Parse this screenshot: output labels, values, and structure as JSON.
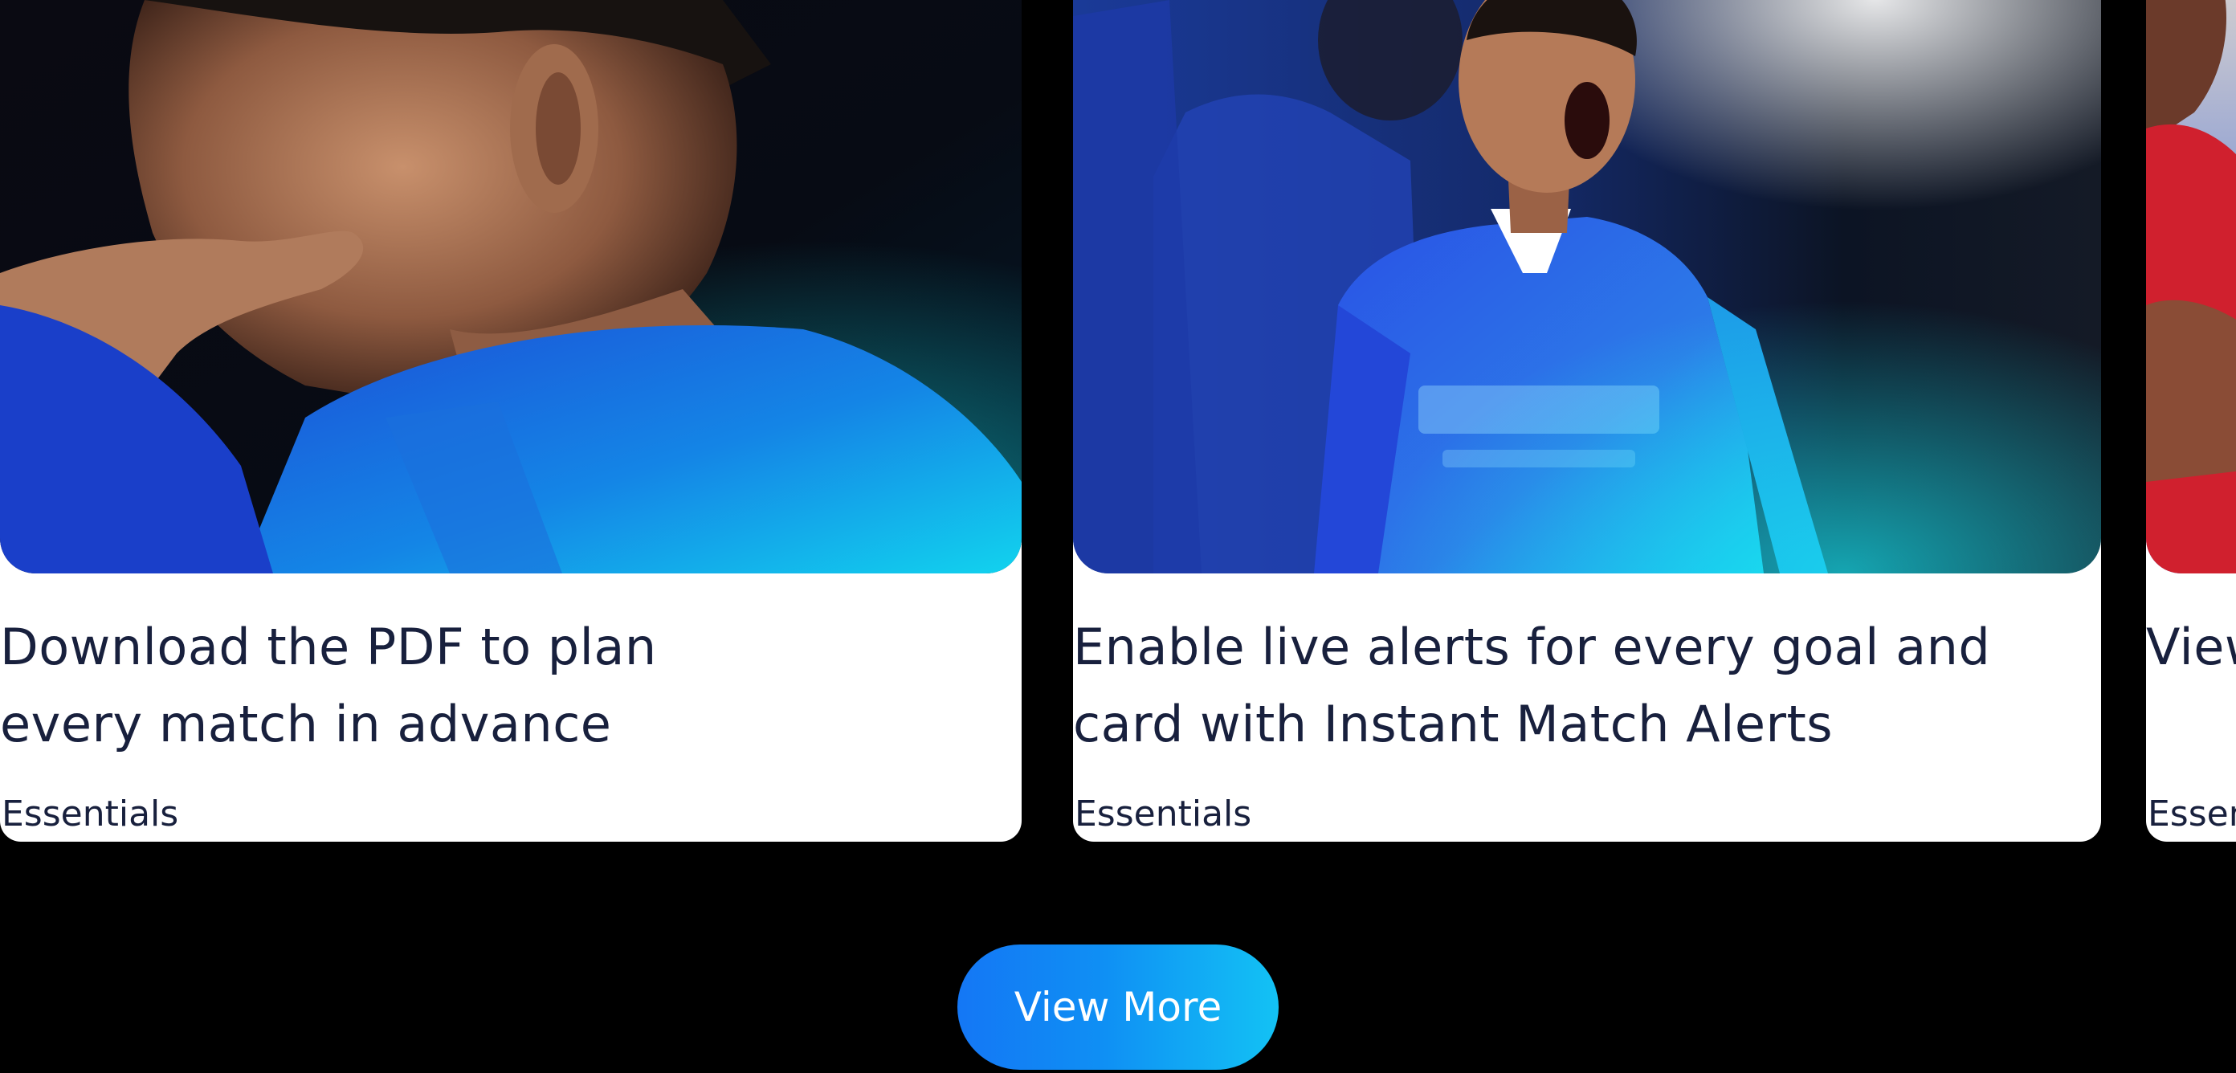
{
  "cards": [
    {
      "title": "Download the PDF to plan every match in advance",
      "tag": "Essentials",
      "image_label": "player-thinking-photo"
    },
    {
      "title": "Enable live alerts for every goal and card with Instant Match Alerts",
      "tag": "Essentials",
      "image_label": "player-celebrating-photo"
    },
    {
      "title": "View performance",
      "tag": "Essentials",
      "image_label": "player-red-kit-photo"
    }
  ],
  "view_more": {
    "label": "View More"
  },
  "colors": {
    "page_bg": "#000000",
    "card_bg": "#ffffff",
    "text": "#18203d",
    "button_gradient_start": "#1477f5",
    "button_gradient_end": "#13c2f4"
  }
}
